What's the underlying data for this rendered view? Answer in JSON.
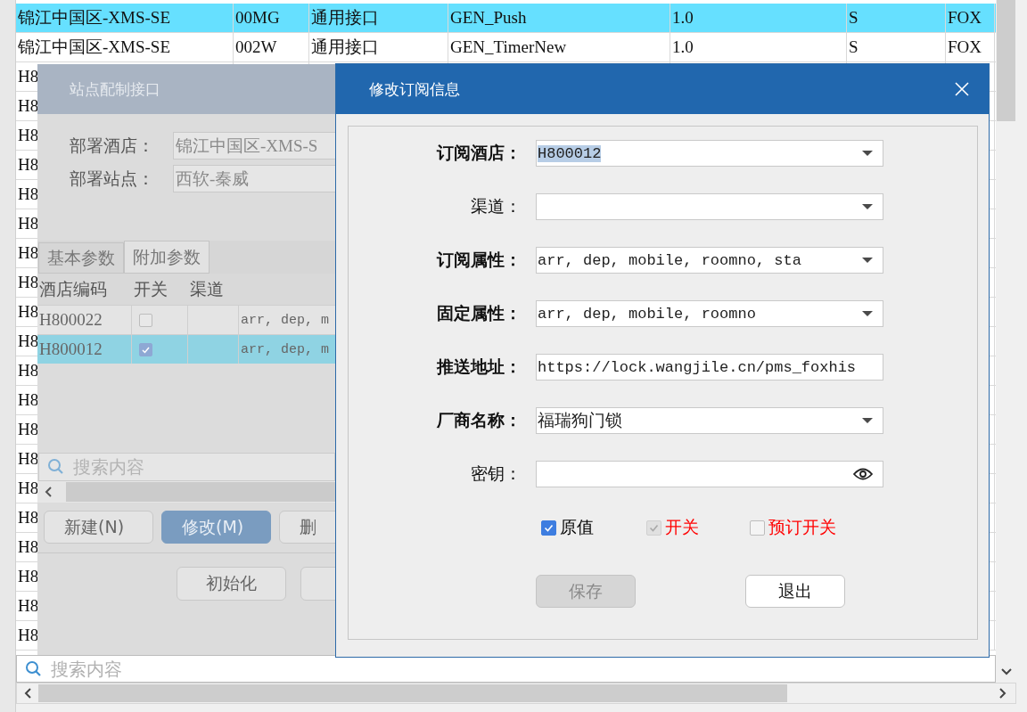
{
  "main_table": {
    "rows": [
      {
        "selected": true,
        "cells": [
          "锦江中国区-XMS-SE",
          "00MG",
          "通用接口",
          "GEN_Push",
          "1.0",
          "S",
          "FOX"
        ]
      },
      {
        "selected": false,
        "cells": [
          "锦江中国区-XMS-SE",
          "002W",
          "通用接口",
          "GEN_TimerNew",
          "1.0",
          "S",
          "FOX"
        ]
      },
      {
        "selected": false,
        "cells": [
          "H8"
        ]
      },
      {
        "selected": false,
        "cells": [
          "H8"
        ]
      },
      {
        "selected": false,
        "cells": [
          "H8"
        ]
      },
      {
        "selected": false,
        "cells": [
          "H8"
        ]
      },
      {
        "selected": false,
        "cells": [
          "H8"
        ]
      },
      {
        "selected": false,
        "cells": [
          "H8"
        ]
      },
      {
        "selected": false,
        "cells": [
          "H8"
        ]
      },
      {
        "selected": false,
        "cells": [
          "H8"
        ]
      },
      {
        "selected": false,
        "cells": [
          "H8"
        ]
      },
      {
        "selected": false,
        "cells": [
          "H8"
        ]
      },
      {
        "selected": false,
        "cells": [
          "H8"
        ]
      },
      {
        "selected": false,
        "cells": [
          "H8"
        ]
      },
      {
        "selected": false,
        "cells": [
          "H8"
        ]
      },
      {
        "selected": false,
        "cells": [
          "H8"
        ]
      },
      {
        "selected": false,
        "cells": [
          "H8"
        ]
      },
      {
        "selected": false,
        "cells": [
          "H8"
        ]
      },
      {
        "selected": false,
        "cells": [
          "H8"
        ]
      },
      {
        "selected": false,
        "cells": [
          "H8"
        ]
      },
      {
        "selected": false,
        "cells": [
          "H8"
        ]
      },
      {
        "selected": false,
        "cells": [
          "H8"
        ]
      }
    ]
  },
  "search": {
    "placeholder": "搜索内容"
  },
  "site_dialog": {
    "title": "站点配制接口",
    "fields": [
      {
        "label": "部署酒店：",
        "value": "锦江中国区-XMS-S",
        "disabled": true
      },
      {
        "label": "部署站点：",
        "value": "西软-秦威",
        "disabled": true
      }
    ],
    "tabs": [
      {
        "label": "基本参数",
        "selected": false
      },
      {
        "label": "附加参数",
        "selected": true
      }
    ],
    "table": {
      "columns": [
        "酒店编码",
        "开关",
        "渠道"
      ],
      "rows": [
        {
          "code": "H800022",
          "checked": false,
          "selected": false,
          "column_4": "arr, dep, m"
        },
        {
          "code": "H800012",
          "checked": true,
          "selected": true,
          "column_4": "arr, dep, m"
        }
      ]
    },
    "search": {
      "placeholder": "搜索内容"
    },
    "buttons": [
      {
        "label": "新建(N)",
        "selected": false
      },
      {
        "label": "修改(M)",
        "selected": true
      },
      {
        "label": "删",
        "selected": false
      }
    ],
    "footer_buttons": [
      {
        "kind": "labeled",
        "label": "初始化"
      },
      {
        "kind": "cut_off"
      }
    ]
  },
  "edit_dialog": {
    "title": "修改订阅信息",
    "fields": [
      {
        "label": "订阅酒店：",
        "bold": true,
        "kind": "dropdown",
        "value": "H800012",
        "text_selected": true
      },
      {
        "label": "渠道：",
        "bold": false,
        "kind": "dropdown"
      },
      {
        "label": "订阅属性：",
        "bold": true,
        "kind": "dropdown",
        "value": "arr, dep, mobile, roomno, sta"
      },
      {
        "label": "固定属性：",
        "bold": true,
        "kind": "dropdown",
        "value": "arr, dep, mobile, roomno"
      },
      {
        "label": "推送地址：",
        "bold": true,
        "kind": "text",
        "value": "https://lock.wangjile.cn/pms_foxhis"
      },
      {
        "label": "厂商名称：",
        "bold": true,
        "kind": "dropdown",
        "value": "福瑞狗门锁"
      },
      {
        "label": "密钥：",
        "bold": false,
        "kind": "password"
      }
    ],
    "checkboxes": [
      {
        "label": "原值",
        "checked": true,
        "disabled": false,
        "color": "#000000"
      },
      {
        "label": "开关",
        "checked": true,
        "disabled": true,
        "color": "#ff0000"
      },
      {
        "label": "预订开关",
        "checked": false,
        "disabled": false,
        "color": "#ff0000"
      }
    ],
    "buttons": [
      {
        "label": "保存",
        "disabled": true
      },
      {
        "label": "退出",
        "disabled": false
      }
    ]
  }
}
